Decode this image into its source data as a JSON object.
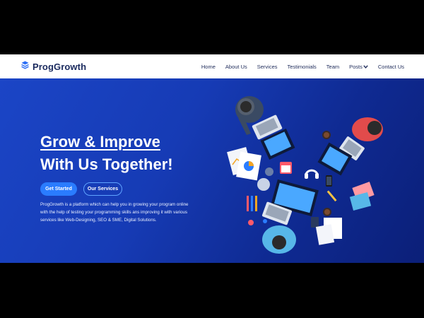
{
  "brand": {
    "name": "ProgGrowth",
    "icon": "layers-icon"
  },
  "nav": {
    "items": [
      {
        "label": "Home"
      },
      {
        "label": "About Us"
      },
      {
        "label": "Services"
      },
      {
        "label": "Testimonials"
      },
      {
        "label": "Team"
      },
      {
        "label": "Posts",
        "has_dropdown": true
      },
      {
        "label": "Contact Us"
      }
    ]
  },
  "hero": {
    "title_line1": "Grow & Improve",
    "title_line2": "With Us Together!",
    "primary_button": "Get Started",
    "secondary_button": "Our Services",
    "description": "ProgGrowth is a platform which can help you in growing your program online with the help of testing your programming skills ans improving it with various services like Web-Designing, SEO & SME, Digital Solutions."
  },
  "colors": {
    "brand_text": "#1a2a5e",
    "hero_gradient_start": "#1b45c6",
    "hero_gradient_end": "#0b1f78",
    "primary_button": "#2a7cff",
    "letterbox": "#000000"
  }
}
